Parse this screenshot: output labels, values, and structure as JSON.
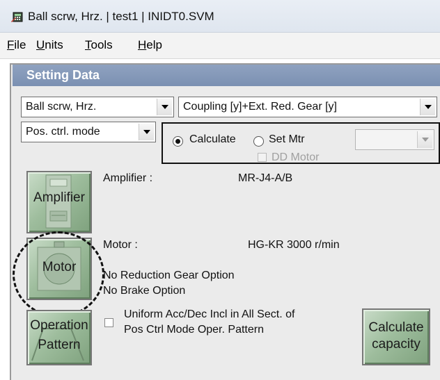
{
  "window": {
    "title": "Ball scrw, Hrz.  | test1 | INIDT0.SVM"
  },
  "menu": {
    "items": [
      {
        "underline": "F",
        "rest": "ile"
      },
      {
        "underline": "U",
        "rest": "nits"
      },
      {
        "underline": "T",
        "rest": "ools"
      },
      {
        "underline": "H",
        "rest": "elp"
      }
    ]
  },
  "setting_data": {
    "header": "Setting Data",
    "mechanism_select": "Ball scrw, Hrz.",
    "coupling_select": "Coupling [y]+Ext. Red. Gear [y]",
    "control_mode_select": "Pos. ctrl. mode",
    "calculate_radio_label": "Calculate",
    "calculate_radio_selected": true,
    "set_mtr_radio_label": "Set Mtr",
    "set_mtr_radio_selected": false,
    "dd_motor_label": "DD Motor",
    "motor_select_value": ""
  },
  "amplifier": {
    "button_label": "Amplifier",
    "label": "Amplifier :",
    "value": "MR-J4-A/B"
  },
  "motor": {
    "button_label": "Motor",
    "label": "Motor :",
    "value": "HG-KR  3000 r/min",
    "reduction_gear": "No Reduction Gear Option",
    "brake": "No Brake Option"
  },
  "operation_pattern": {
    "button_label_line1": "Operation",
    "button_label_line2": "Pattern",
    "checkbox_line1": "Uniform Acc/Dec Incl in All Sect. of",
    "checkbox_line2": "Pos Ctrl Mode Oper. Pattern",
    "checkbox_checked": false
  },
  "calculate": {
    "label_line1": "Calculate",
    "label_line2": "capacity"
  },
  "colors": {
    "header_bg": "#7b90b2",
    "button_green": "#9ebd9d"
  }
}
